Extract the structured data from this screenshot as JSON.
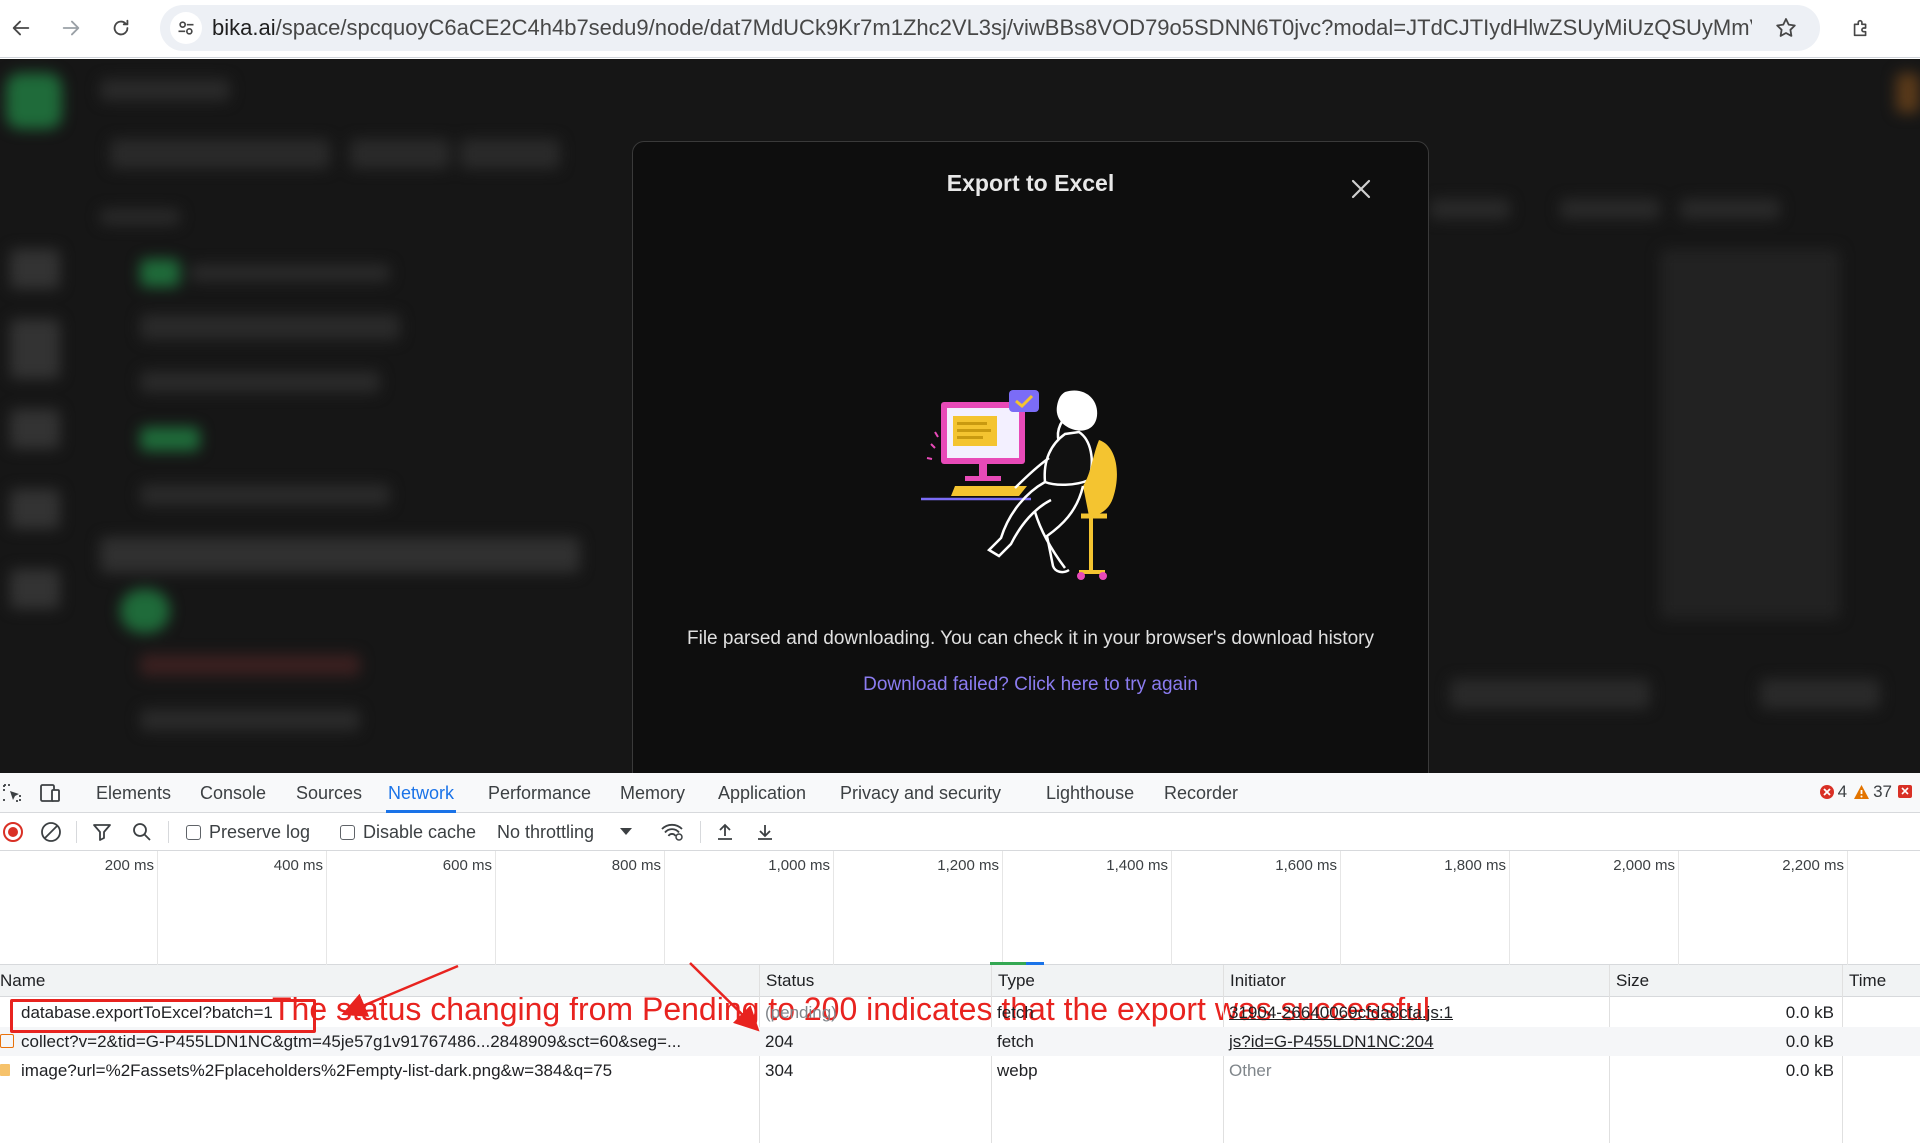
{
  "browser": {
    "url_domain": "bika.ai",
    "url_path": "/space/spcquoyC6aCE2C4h4b7sedu9/node/dat7MdUCk9Kr7m1Zhc2VL3sj/viwBBs8VOD79o5SDNN6T0jvc?modal=JTdCJTIydHlwZSUyMiUzQSUyMmV4cG9..."
  },
  "modal": {
    "title": "Export to Excel",
    "message": "File parsed and downloading. You can check it in your browser's download history",
    "retry_link": "Download failed? Click here to try again"
  },
  "devtools": {
    "tabs": [
      "Elements",
      "Console",
      "Sources",
      "Network",
      "Performance",
      "Memory",
      "Application",
      "Privacy and security",
      "Lighthouse",
      "Recorder"
    ],
    "active_tab": "Network",
    "errors_count": "4",
    "warnings_count": "37",
    "toolbar": {
      "preserve_log": "Preserve log",
      "disable_cache": "Disable cache",
      "throttling": "No throttling"
    },
    "timeline_ticks": [
      "200 ms",
      "400 ms",
      "600 ms",
      "800 ms",
      "1,000 ms",
      "1,200 ms",
      "1,400 ms",
      "1,600 ms",
      "1,800 ms",
      "2,000 ms",
      "2,200 ms"
    ],
    "annotation": "The status changing from Pending to 200 indicates that the export was successful",
    "columns": [
      "Name",
      "Status",
      "Type",
      "Initiator",
      "Size",
      "Time"
    ],
    "rows": [
      {
        "name": "database.exportToExcel?batch=1",
        "status": "(pending)",
        "type": "fetch",
        "initiator": "31904-26640069cfda8cfa.js:1",
        "size": "0.0 kB"
      },
      {
        "name": "collect?v=2&tid=G-P455LDN1NC&gtm=45je57g1v91767486...2848909&sct=60&seg=...",
        "status": "204",
        "type": "fetch",
        "initiator": "js?id=G-P455LDN1NC:204",
        "size": "0.0 kB"
      },
      {
        "name": "image?url=%2Fassets%2Fplaceholders%2Fempty-list-dark.png&w=384&q=75",
        "status": "304",
        "type": "webp",
        "initiator": "Other",
        "size": "0.0 kB"
      }
    ]
  },
  "colors": {
    "annotation": "#e8231f",
    "link": "#8b7cf0",
    "devtools_active": "#1a73e8"
  }
}
